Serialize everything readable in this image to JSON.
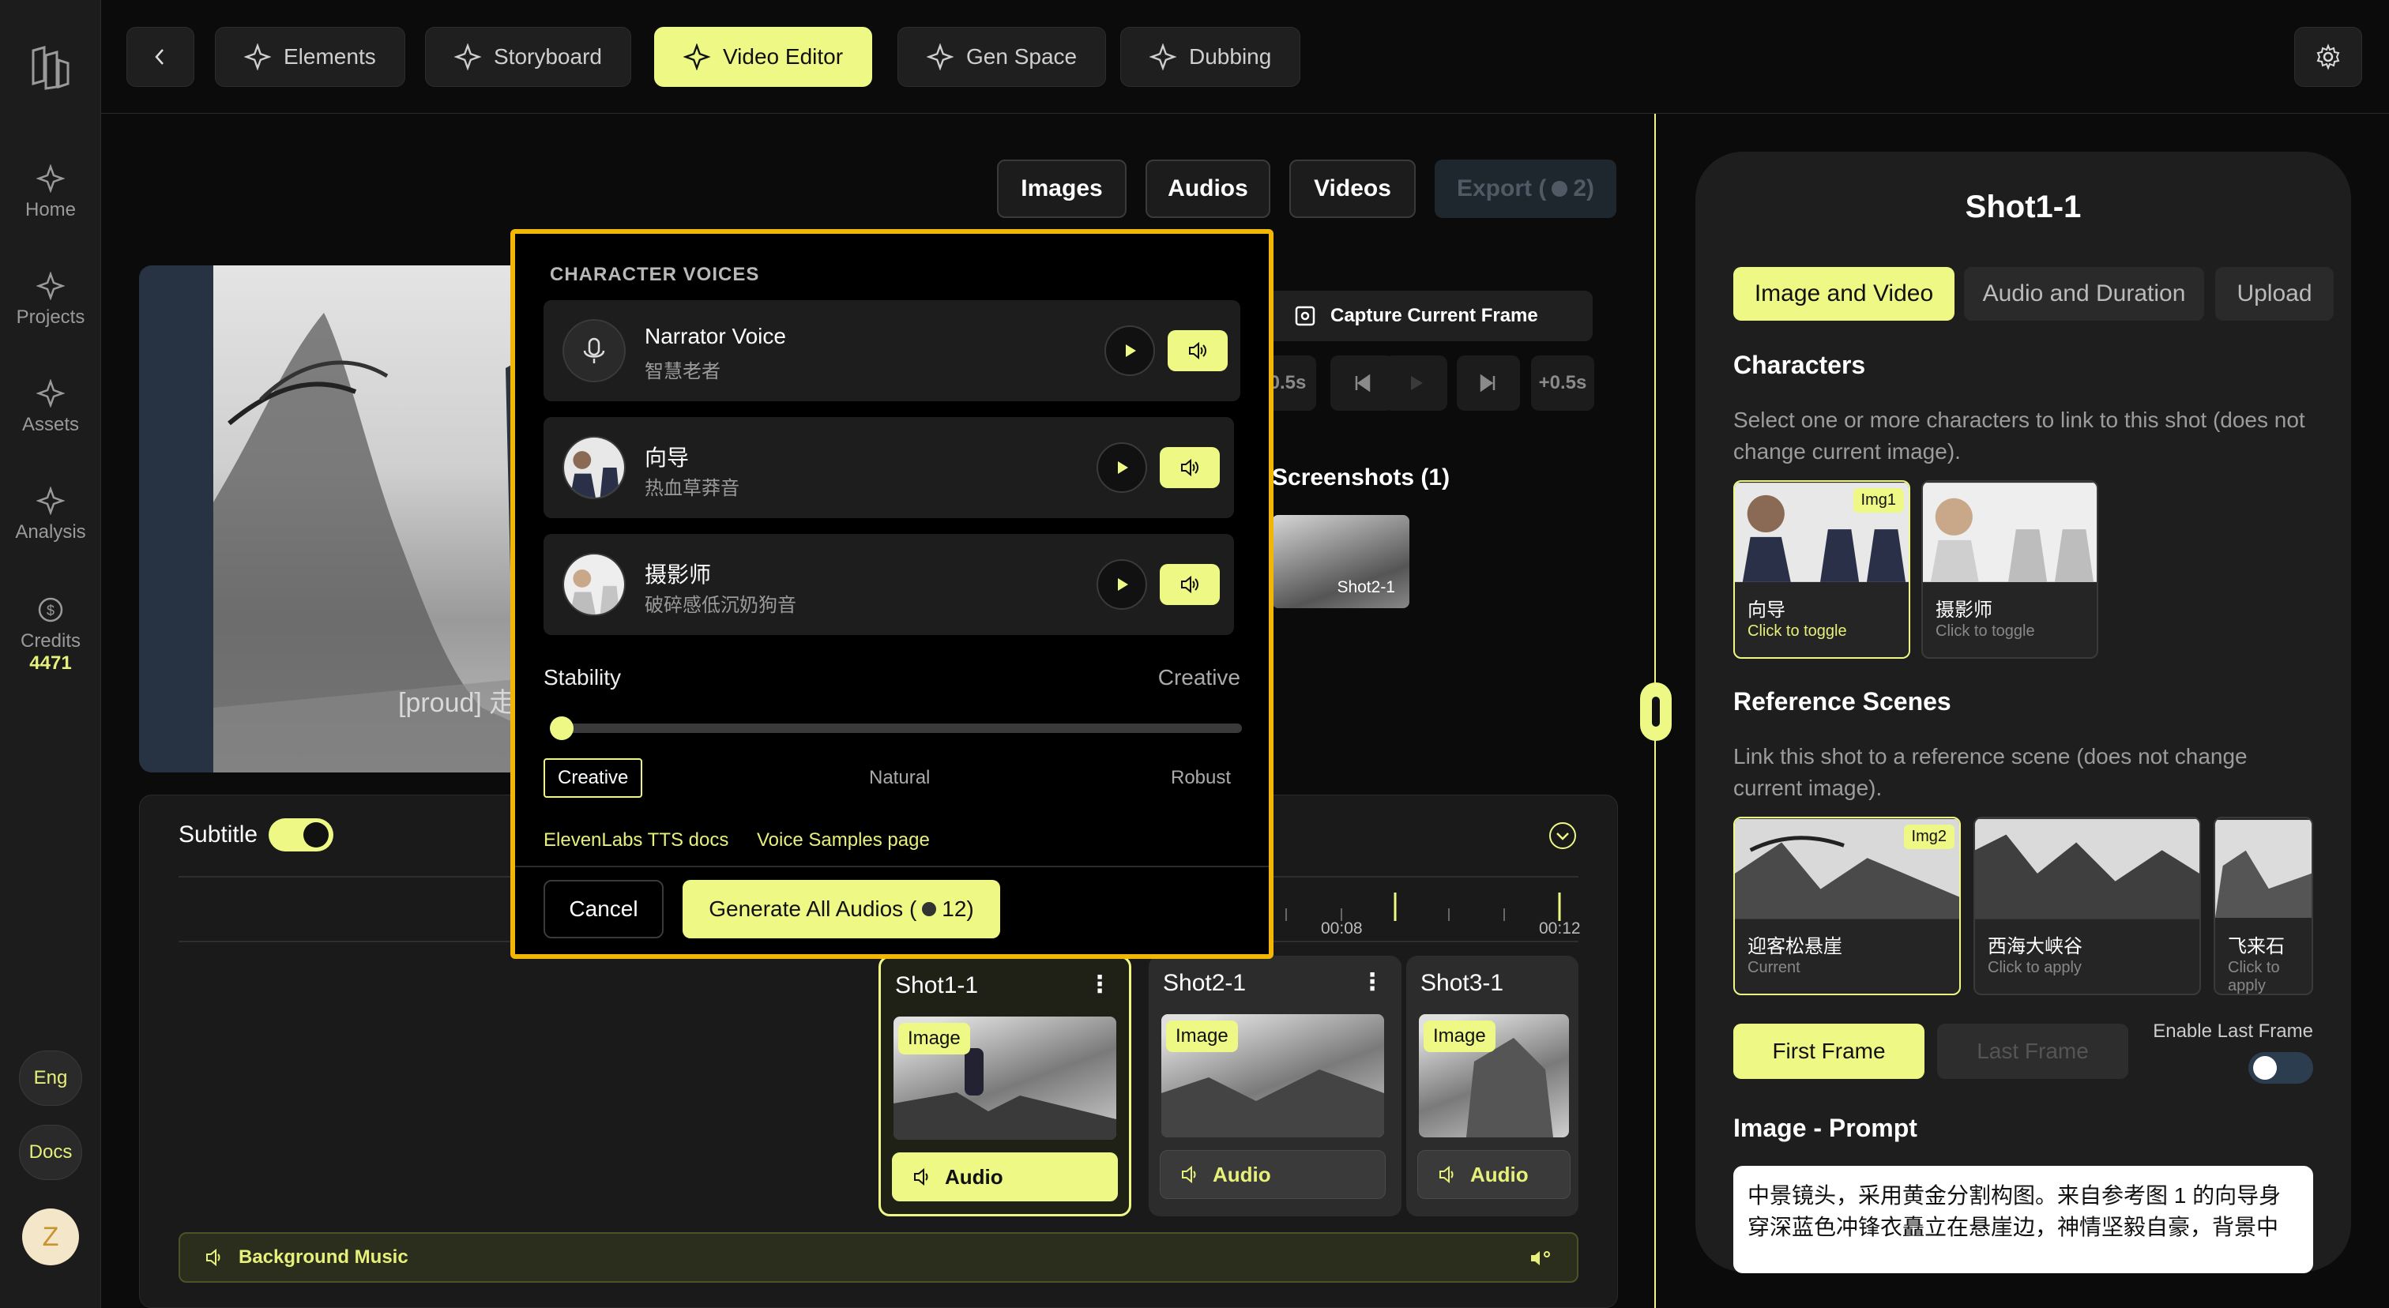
{
  "sidebar": {
    "items": [
      {
        "label": "Home",
        "icon": "sparkle-icon"
      },
      {
        "label": "Projects",
        "icon": "sparkle-icon"
      },
      {
        "label": "Assets",
        "icon": "sparkle-icon"
      },
      {
        "label": "Analysis",
        "icon": "sparkle-icon"
      }
    ],
    "credits_label": "Credits",
    "credits_value": "4471",
    "lang_label": "Eng",
    "docs_label": "Docs",
    "avatar_initial": "Z"
  },
  "topbar": {
    "tabs": [
      "Elements",
      "Storyboard",
      "Video Editor",
      "Gen Space",
      "Dubbing"
    ],
    "active_tab": "Video Editor"
  },
  "media_buttons": [
    "Images",
    "Audios",
    "Videos"
  ],
  "export_label": "Export (",
  "export_count": "2)",
  "preview": {
    "subtitle_fragment": "[proud] 走"
  },
  "capture_label": "Capture Current Frame",
  "controls": [
    "-0.5s",
    "+0.5s"
  ],
  "screenshots": {
    "title": "Screenshots (1)",
    "items": [
      "Shot2-1"
    ]
  },
  "timeline": {
    "subtitle_label": "Subtitle",
    "subtitle_on": true,
    "ticks": [
      "00:08",
      "00:12"
    ],
    "shots": [
      {
        "name": "Shot1-1",
        "badge": "Image",
        "audio": "Audio",
        "selected": true
      },
      {
        "name": "Shot2-1",
        "badge": "Image",
        "audio": "Audio",
        "selected": false
      },
      {
        "name": "Shot3-1",
        "badge": "Image",
        "audio": "Audio",
        "selected": false
      }
    ],
    "background_music": "Background Music"
  },
  "right_panel": {
    "title": "Shot1-1",
    "tabs": [
      "Image and Video",
      "Audio and Duration",
      "Upload"
    ],
    "active_tab": "Image and Video",
    "characters_heading": "Characters",
    "characters_desc": "Select one or more characters to link to this shot (does not change current image).",
    "characters": [
      {
        "name": "向导",
        "hint": "Click to toggle",
        "badge": "Img1",
        "selected": true
      },
      {
        "name": "摄影师",
        "hint": "Click to toggle",
        "badge": "",
        "selected": false
      }
    ],
    "scenes_heading": "Reference Scenes",
    "scenes_desc": "Link this shot to a reference scene (does not change current image).",
    "scenes": [
      {
        "name": "迎客松悬崖",
        "hint": "Current",
        "badge": "Img2",
        "selected": true
      },
      {
        "name": "西海大峡谷",
        "hint": "Click to apply",
        "badge": "",
        "selected": false
      },
      {
        "name": "飞来石",
        "hint": "Click to apply",
        "badge": "",
        "selected": false
      }
    ],
    "first_frame": "First Frame",
    "last_frame": "Last Frame",
    "enable_last_frame": "Enable Last Frame",
    "enable_last_frame_on": false,
    "prompt_heading": "Image - Prompt",
    "prompt_text": "中景镜头，采用黄金分割构图。来自参考图 1 的向导身穿深蓝色冲锋衣矗立在悬崖边，神情坚毅自豪，背景中"
  },
  "modal": {
    "title": "CHARACTER VOICES",
    "voices": [
      {
        "name": "Narrator Voice",
        "sub": "智慧老者"
      },
      {
        "name": "向导",
        "sub": "热血草莽音"
      },
      {
        "name": "摄影师",
        "sub": "破碎感低沉奶狗音"
      }
    ],
    "stability_label": "Stability",
    "stability_value_label": "Creative",
    "stability_level": 0.0,
    "options": [
      "Creative",
      "Natural",
      "Robust"
    ],
    "selected_option": "Creative",
    "link_docs": "ElevenLabs TTS docs",
    "link_samples": "Voice Samples page",
    "cancel_label": "Cancel",
    "generate_label": "Generate All Audios (",
    "generate_count": "12)"
  },
  "colors": {
    "accent": "#eef884",
    "modal_border": "#f2b705",
    "bg": "#0b0b0b"
  }
}
